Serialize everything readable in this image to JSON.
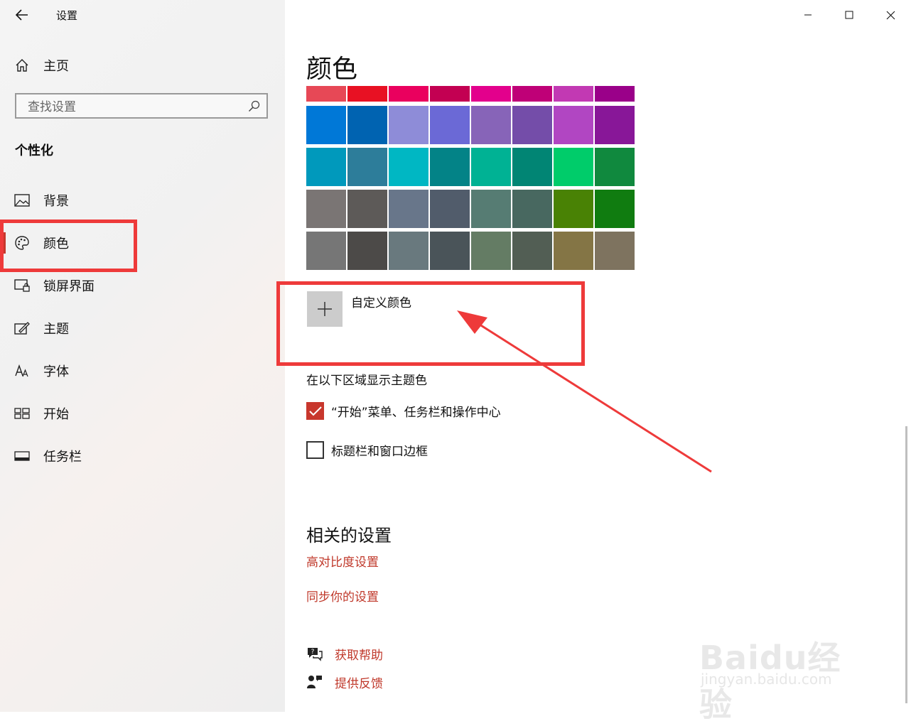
{
  "app": {
    "title": "设置"
  },
  "sidebar": {
    "home": "主页",
    "search_placeholder": "查找设置",
    "section": "个性化",
    "items": [
      {
        "label": "背景",
        "icon": "image-icon"
      },
      {
        "label": "颜色",
        "icon": "palette-icon",
        "selected": true
      },
      {
        "label": "锁屏界面",
        "icon": "lock-screen-icon"
      },
      {
        "label": "主题",
        "icon": "theme-icon"
      },
      {
        "label": "字体",
        "icon": "font-icon"
      },
      {
        "label": "开始",
        "icon": "start-icon"
      },
      {
        "label": "任务栏",
        "icon": "taskbar-icon"
      }
    ]
  },
  "main": {
    "title": "颜色",
    "swatches": [
      [
        "#e74856",
        "#e81123",
        "#ea005e",
        "#c30052",
        "#e3008c",
        "#bf0077",
        "#c239b3",
        "#9a0089"
      ],
      [
        "#0078d7",
        "#0063b1",
        "#8e8cd8",
        "#6b69d6",
        "#8764b8",
        "#744da9",
        "#b146c2",
        "#881798"
      ],
      [
        "#0099bc",
        "#2d7d9a",
        "#00b7c3",
        "#038387",
        "#00b294",
        "#018574",
        "#00cc6a",
        "#10893e"
      ],
      [
        "#7a7574",
        "#5d5a58",
        "#68768a",
        "#515c6b",
        "#567c73",
        "#486860",
        "#498205",
        "#107c10"
      ],
      [
        "#767676",
        "#4c4a48",
        "#69797e",
        "#4a5459",
        "#647c64",
        "#525e54",
        "#847545",
        "#7e735f"
      ]
    ],
    "custom_color": "自定义颜色",
    "show_accent_label": "在以下区域显示主题色",
    "checkboxes": [
      {
        "label": "“开始”菜单、任务栏和操作中心",
        "checked": true
      },
      {
        "label": "标题栏和窗口边框",
        "checked": false
      }
    ],
    "related_title": "相关的设置",
    "related_links": [
      "高对比度设置",
      "同步你的设置"
    ],
    "help": {
      "get_help": "获取帮助",
      "feedback": "提供反馈"
    }
  },
  "accent_color": "#c8372d",
  "annotation_color": "#ee3a3a",
  "watermark": {
    "main": "Baidu经验",
    "sub": "jingyan.baidu.com"
  }
}
